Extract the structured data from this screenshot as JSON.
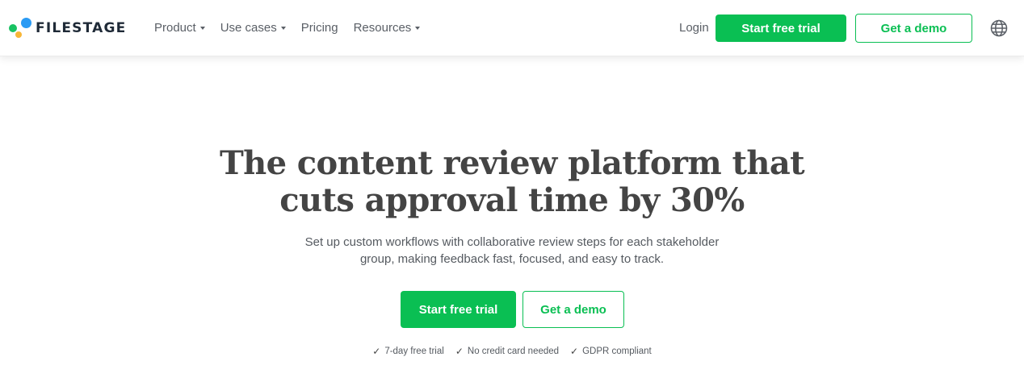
{
  "colors": {
    "brand_green": "#0abf53",
    "logo_blue": "#2b9bf4",
    "logo_green": "#18c262",
    "logo_yellow": "#f8b637"
  },
  "logo": {
    "text": "FILESTAGE"
  },
  "nav": {
    "items": [
      {
        "label": "Product",
        "has_dropdown": true
      },
      {
        "label": "Use cases",
        "has_dropdown": true
      },
      {
        "label": "Pricing",
        "has_dropdown": false
      },
      {
        "label": "Resources",
        "has_dropdown": true
      }
    ]
  },
  "header_actions": {
    "login": "Login",
    "start_trial": "Start free trial",
    "get_demo": "Get a demo",
    "language_icon": "globe-icon"
  },
  "hero": {
    "headline_line1": "The content review platform that",
    "headline_line2": "cuts approval time by 30%",
    "subtext_line1": "Set up custom workflows with collaborative review steps for each stakeholder",
    "subtext_line2": "group, making feedback fast, focused, and easy to track.",
    "start_trial": "Start free trial",
    "get_demo": "Get a demo",
    "trust_items": [
      "7-day free trial",
      "No credit card needed",
      "GDPR compliant"
    ],
    "check_glyph": "✓"
  }
}
